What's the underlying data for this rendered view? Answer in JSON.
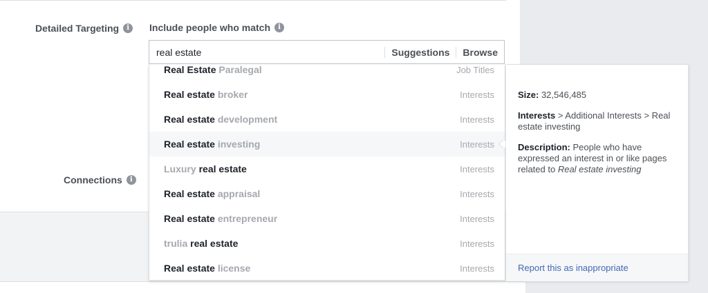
{
  "targeting": {
    "label": "Detailed Targeting",
    "include_label": "Include people who match",
    "info_icon_glyph": "i"
  },
  "connections": {
    "label": "Connections"
  },
  "search": {
    "value": "real estate",
    "suggestions_label": "Suggestions",
    "browse_label": "Browse"
  },
  "dropdown": {
    "items": [
      {
        "pre": "",
        "match": "Real Estate",
        "rest": " Paralegal",
        "category": "Job Titles"
      },
      {
        "pre": "",
        "match": "Real estate",
        "rest": " broker",
        "category": "Interests"
      },
      {
        "pre": "",
        "match": "Real estate",
        "rest": " development",
        "category": "Interests"
      },
      {
        "pre": "",
        "match": "Real estate",
        "rest": " investing",
        "category": "Interests"
      },
      {
        "pre": "Luxury ",
        "match": "real estate",
        "rest": "",
        "category": "Interests"
      },
      {
        "pre": "",
        "match": "Real estate",
        "rest": " appraisal",
        "category": "Interests"
      },
      {
        "pre": "",
        "match": "Real estate",
        "rest": " entrepreneur",
        "category": "Interests"
      },
      {
        "pre": "trulia ",
        "match": "real estate",
        "rest": "",
        "category": "Interests"
      },
      {
        "pre": "",
        "match": "Real estate",
        "rest": " license",
        "category": "Interests"
      }
    ],
    "hover_index": 3
  },
  "detail": {
    "size_label": "Size:",
    "size_value": " 32,546,485",
    "path_head": "Interests",
    "path_tail": " > Additional Interests > Real estate investing",
    "desc_label": "Description:",
    "desc_text": " People who have expressed an interest in or like pages related to ",
    "desc_italic": "Real estate investing",
    "report_link": "Report this as inappropriate"
  },
  "colors": {
    "link": "#4267b2",
    "muted": "#a5a8ad",
    "label": "#4b4f56"
  }
}
